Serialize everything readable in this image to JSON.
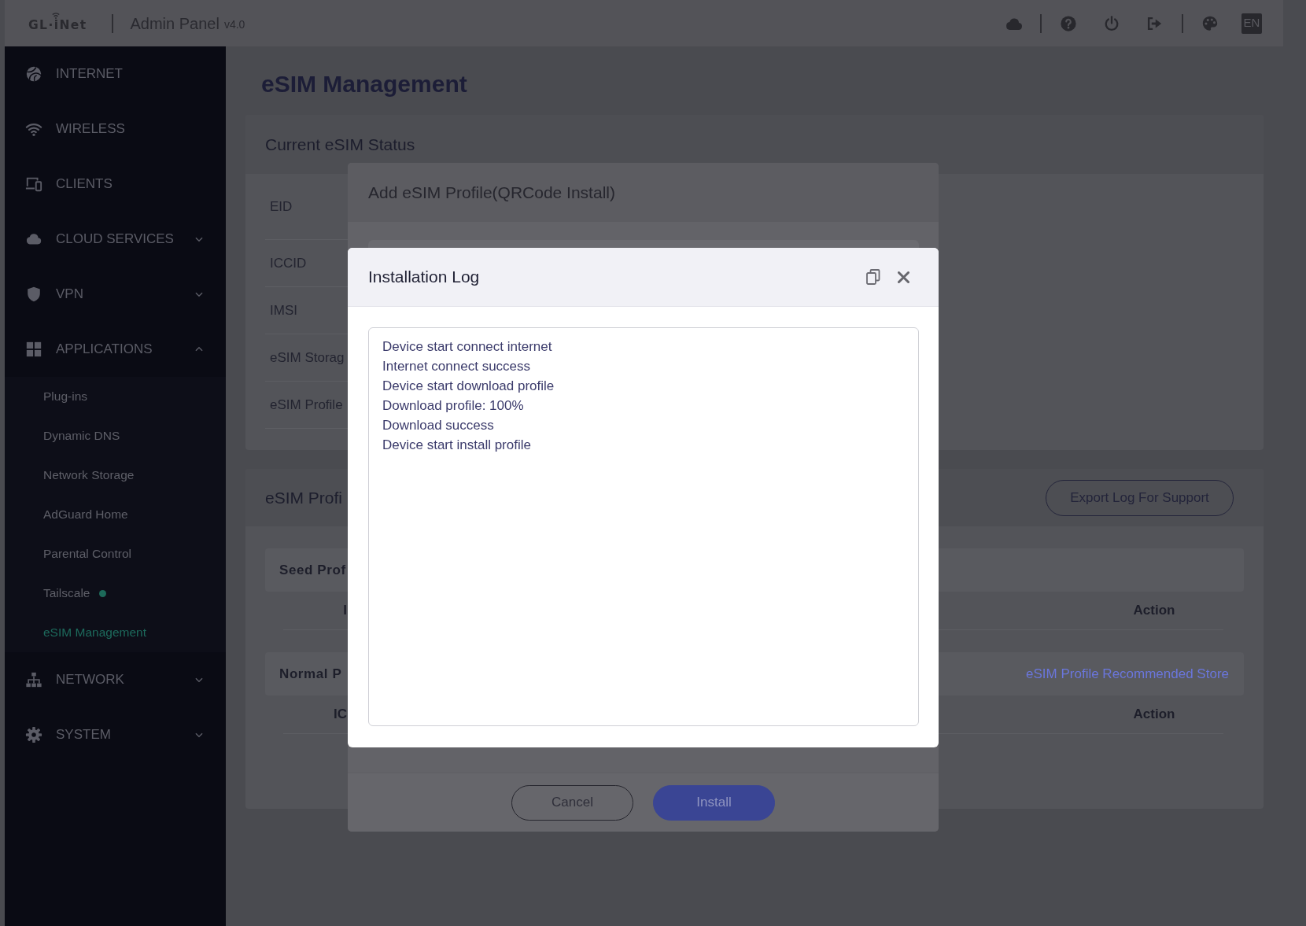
{
  "header": {
    "logo": "GL·iNet",
    "title": "Admin Panel",
    "version": "v4.0",
    "language": "EN"
  },
  "sidebar": {
    "items": [
      {
        "label": "INTERNET"
      },
      {
        "label": "WIRELESS"
      },
      {
        "label": "CLIENTS"
      },
      {
        "label": "CLOUD SERVICES",
        "expanded": false
      },
      {
        "label": "VPN",
        "expanded": false
      },
      {
        "label": "APPLICATIONS",
        "expanded": true,
        "children": [
          {
            "label": "Plug-ins",
            "selected": false
          },
          {
            "label": "Dynamic DNS",
            "selected": false
          },
          {
            "label": "Network Storage",
            "selected": false
          },
          {
            "label": "AdGuard Home",
            "selected": false
          },
          {
            "label": "Parental Control",
            "selected": false
          },
          {
            "label": "Tailscale",
            "selected": false,
            "color": "#1d6a5a"
          },
          {
            "label": "eSIM Management",
            "selected": true
          }
        ]
      },
      {
        "label": "NETWORK",
        "expanded": false
      },
      {
        "label": "SYSTEM",
        "expanded": false
      }
    ]
  },
  "page": {
    "title": "eSIM Management"
  },
  "status_card": {
    "title": "Current eSIM Status",
    "rows": [
      "EID",
      "ICCID",
      "IMSI",
      "eSIM Storag",
      "eSIM Profile"
    ]
  },
  "profiles_card": {
    "title": "eSIM Profi",
    "export_button": "Export Log For Support",
    "sections": [
      {
        "title": "Seed Prof",
        "columns": [
          "I",
          "Action"
        ]
      },
      {
        "title": "Normal P",
        "link": "eSIM Profile Recommended Store",
        "columns": [
          "IC",
          "Action"
        ]
      }
    ]
  },
  "add_dialog": {
    "title": "Add eSIM Profile(QRCode Install)",
    "buttons": [
      {
        "label": "Cancel",
        "kind": "secondary"
      },
      {
        "label": "Install",
        "kind": "primary"
      }
    ]
  },
  "log_dialog": {
    "title": "Installation Log",
    "lines": [
      "Device start connect internet",
      "Internet connect success",
      "Device start download profile",
      "Download profile: 100%",
      "Download success",
      "Device start install profile"
    ]
  }
}
